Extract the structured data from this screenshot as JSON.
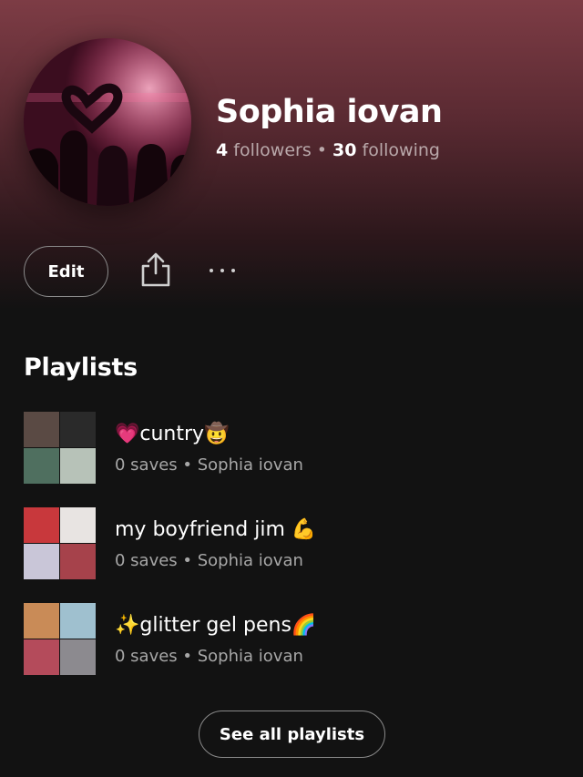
{
  "profile": {
    "name": "Sophia iovan",
    "followers_count": "4",
    "followers_label": "followers",
    "separator": "•",
    "following_count": "30",
    "following_label": "following"
  },
  "actions": {
    "edit_label": "Edit",
    "share_icon": "share-icon",
    "more_icon": "more-options-icon"
  },
  "playlists": {
    "section_title": "Playlists",
    "items": [
      {
        "title": "💗cuntry🤠",
        "subtitle": "0 saves • Sophia iovan",
        "cover_colors": [
          "#5a4a44",
          "#2a2a2a",
          "#4f6f5f",
          "#b7c2b8"
        ]
      },
      {
        "title": "my boyfriend jim 💪",
        "subtitle": "0 saves • Sophia iovan",
        "cover_colors": [
          "#c8383c",
          "#e8e4e2",
          "#c9c6d8",
          "#a6424b"
        ]
      },
      {
        "title": "✨glitter gel pens🌈",
        "subtitle": "0 saves • Sophia iovan",
        "cover_colors": [
          "#c98b57",
          "#9fc0cf",
          "#b44b5b",
          "#8c8a8f"
        ]
      }
    ],
    "see_all_label": "See all playlists"
  },
  "colors": {
    "header_top": "#7d3c45",
    "background": "#121212",
    "secondary_text": "#a7a7a7"
  }
}
